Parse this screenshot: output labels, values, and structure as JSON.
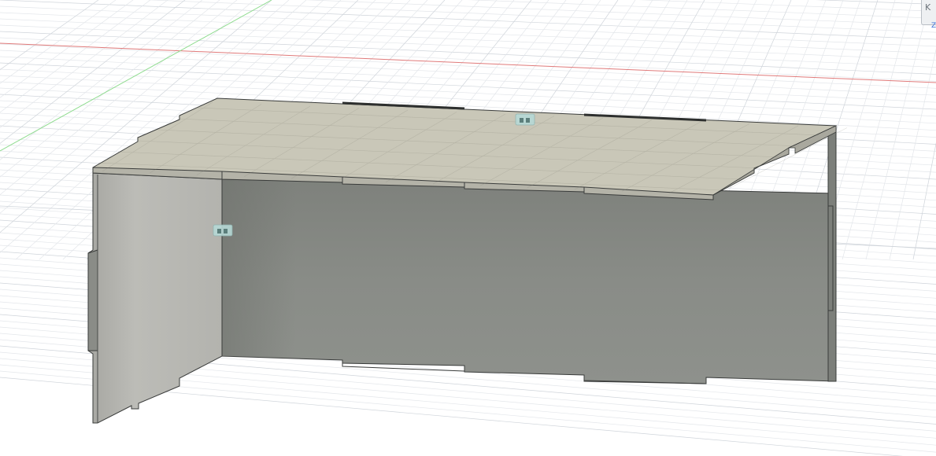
{
  "viewcube": {
    "face_label": "K",
    "axis_label": "Z"
  },
  "colors": {
    "background": "#ffffff",
    "grid_minor": "#e3e6ea",
    "grid_major": "#cfd4da",
    "x_axis": "#e06060",
    "y_axis": "#6fd36f",
    "top_panel": "#c7c5b6",
    "panel_edge": "#3a3c3b",
    "back_panel": "#8a8d88",
    "side_panel": "#b0b0aa",
    "joint_marker": "#9fc7c4"
  },
  "icons": {
    "joint_marker_top": "joint-glyph-icon",
    "joint_marker_side": "joint-glyph-icon"
  }
}
